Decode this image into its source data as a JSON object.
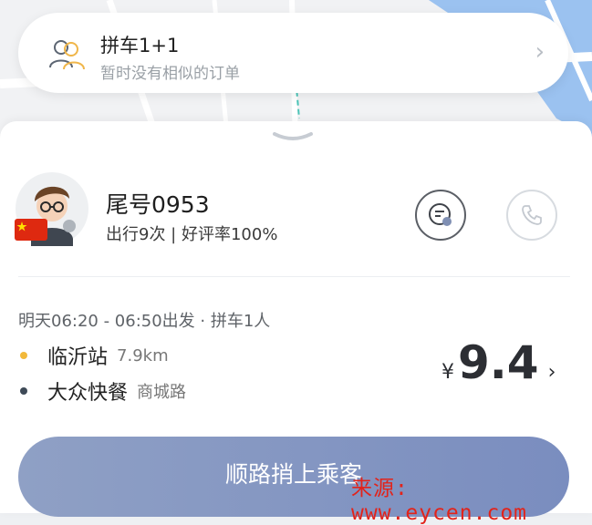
{
  "carpool": {
    "title": "拼车1+1",
    "subtitle": "暂时没有相似的订单"
  },
  "driver": {
    "name": "尾号0953",
    "stats": "出行9次 | 好评率100%"
  },
  "trip": {
    "time": "明天06:20 - 06:50出发 · 拼车1人",
    "from": {
      "name": "临沂站",
      "detail": "7.9km"
    },
    "to": {
      "name": "大众快餐",
      "detail": "商城路"
    },
    "price": {
      "currency": "¥",
      "value": "9.4"
    }
  },
  "action": {
    "label": "顺路捎上乘客"
  },
  "watermark": "来源: www.eycen.com",
  "colors": {
    "from_dot": "#f2b93b",
    "to_dot": "#3e4a57",
    "cta": "#8595c4",
    "watermark": "#e2231a"
  }
}
